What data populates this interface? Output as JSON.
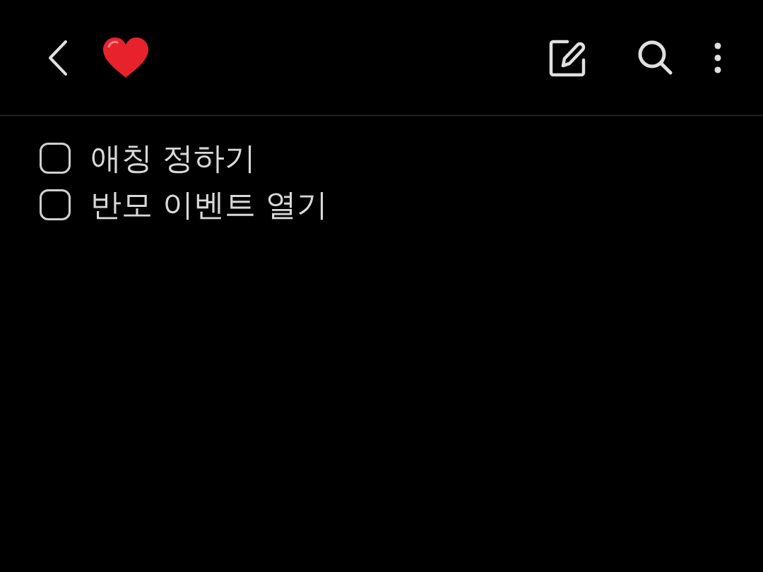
{
  "items": [
    {
      "text": "애칭 정하기",
      "checked": false
    },
    {
      "text": "반모 이벤트 열기",
      "checked": false
    }
  ]
}
